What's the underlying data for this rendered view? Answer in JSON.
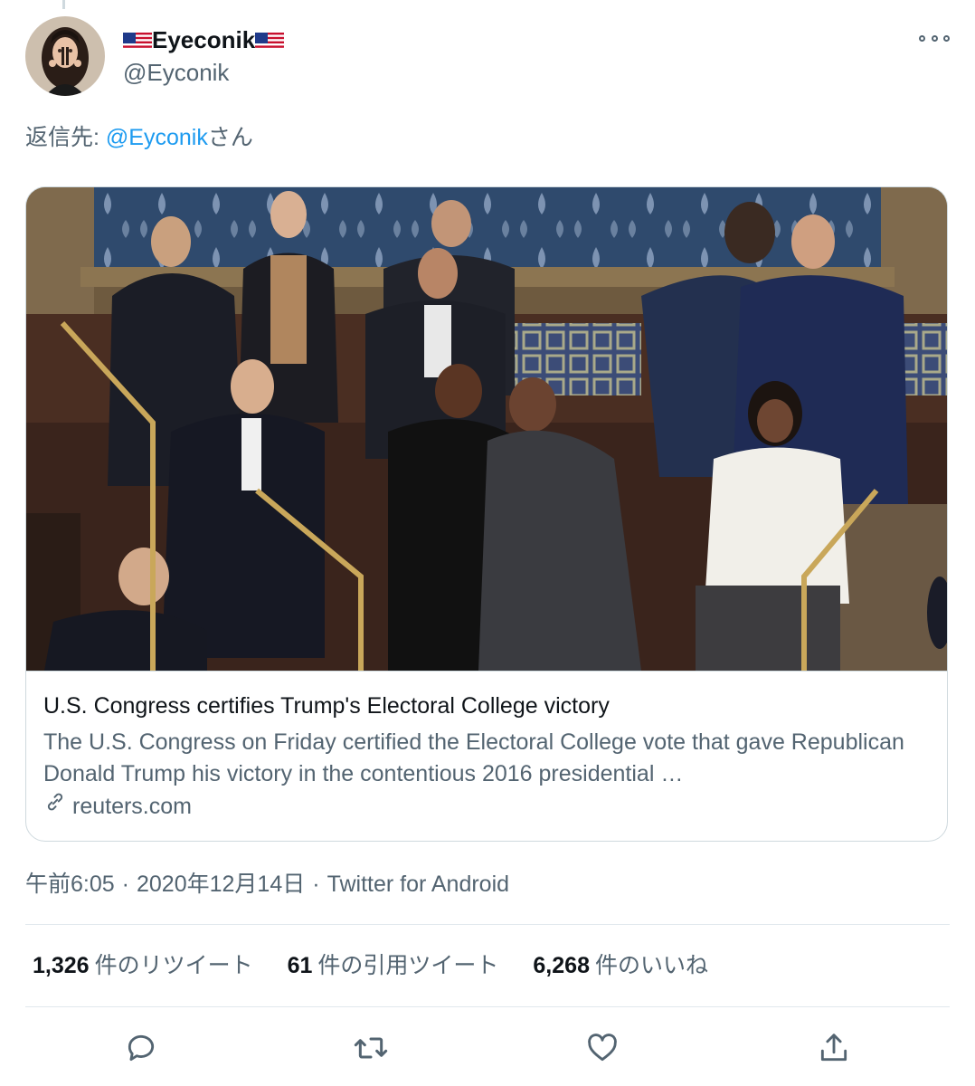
{
  "tweet": {
    "display_name": "Eyeconik",
    "handle": "@Eyconik",
    "reply_prefix": "返信先: ",
    "reply_mention": "@Eyconik",
    "reply_suffix": "さん",
    "flag_icon": "us-flag-icon",
    "more_icon": "more-options-icon"
  },
  "card": {
    "title": "U.S. Congress certifies Trump's Electoral College victory",
    "description": "The U.S. Congress on Friday certified the Electoral College vote that gave Republican Donald Trump his victory in the contentious 2016 presidential …",
    "domain": "reuters.com",
    "link_icon": "link-icon"
  },
  "meta": {
    "time": "午前6:05",
    "date": "2020年12月14日",
    "source": "Twitter for Android",
    "separator": "·"
  },
  "stats": {
    "retweets_count": "1,326",
    "retweets_label": "件のリツイート",
    "quotes_count": "61",
    "quotes_label": "件の引用ツイート",
    "likes_count": "6,268",
    "likes_label": "件のいいね"
  },
  "actions": [
    "reply-icon",
    "retweet-icon",
    "like-icon",
    "share-icon"
  ],
  "colors": {
    "accent": "#1d9bf0",
    "secondary_text": "#536471",
    "border": "#cfd9de"
  }
}
